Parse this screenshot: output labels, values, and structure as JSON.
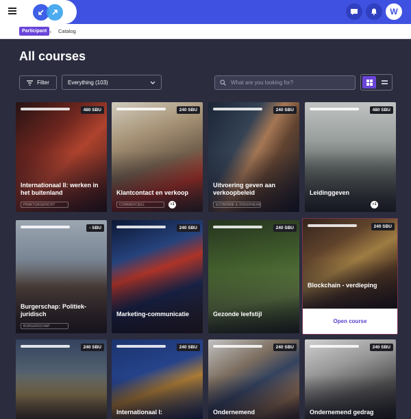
{
  "header": {
    "avatar_initial": "W",
    "brand_color": "#3f51e0"
  },
  "breadcrumb": {
    "role_badge": "Participant",
    "separator": "›",
    "current": "Catalog"
  },
  "page": {
    "title": "All courses"
  },
  "controls": {
    "filter_label": "Filter",
    "category_select": "Everything (103)",
    "search_placeholder": "What are you looking for?",
    "active_view": "grid"
  },
  "courses": [
    {
      "title": "Internationaal II: werken in het buitenland",
      "sbu": "480 SBU",
      "tag": "PRAKTIJKGERICHT",
      "extra": ""
    },
    {
      "title": "Klantcontact en verkoop",
      "sbu": "240 SBU",
      "tag": "COMMERCIEEL",
      "extra": "+1"
    },
    {
      "title": "Uitvoering geven aan verkoopbeleid",
      "sbu": "240 SBU",
      "tag": "ECONOMIE & ONDERNEMEN",
      "extra": ""
    },
    {
      "title": "Leidinggeven",
      "sbu": "480 SBU",
      "tag": "",
      "extra": "+1"
    },
    {
      "title": "Burgerschap: Politiek-juridisch",
      "sbu": "- SBU",
      "tag": "BURGERSCHAP",
      "extra": ""
    },
    {
      "title": "Marketing-communicatie",
      "sbu": "240 SBU",
      "tag": "",
      "extra": ""
    },
    {
      "title": "Gezonde leefstijl",
      "sbu": "240 SBU",
      "tag": "",
      "extra": ""
    },
    {
      "title": "Blockchain - verdieping",
      "sbu": "240 SBU",
      "tag": "",
      "extra": "",
      "action": "Open course"
    },
    {
      "title": "",
      "sbu": "240 SBU",
      "tag": "",
      "extra": ""
    },
    {
      "title": "Internationaal I:",
      "sbu": "240 SBU",
      "tag": "",
      "extra": ""
    },
    {
      "title": "Ondernemend",
      "sbu": "240 SBU",
      "tag": "",
      "extra": ""
    },
    {
      "title": "Ondernemend gedrag",
      "sbu": "240 SBU",
      "tag": "",
      "extra": ""
    }
  ]
}
